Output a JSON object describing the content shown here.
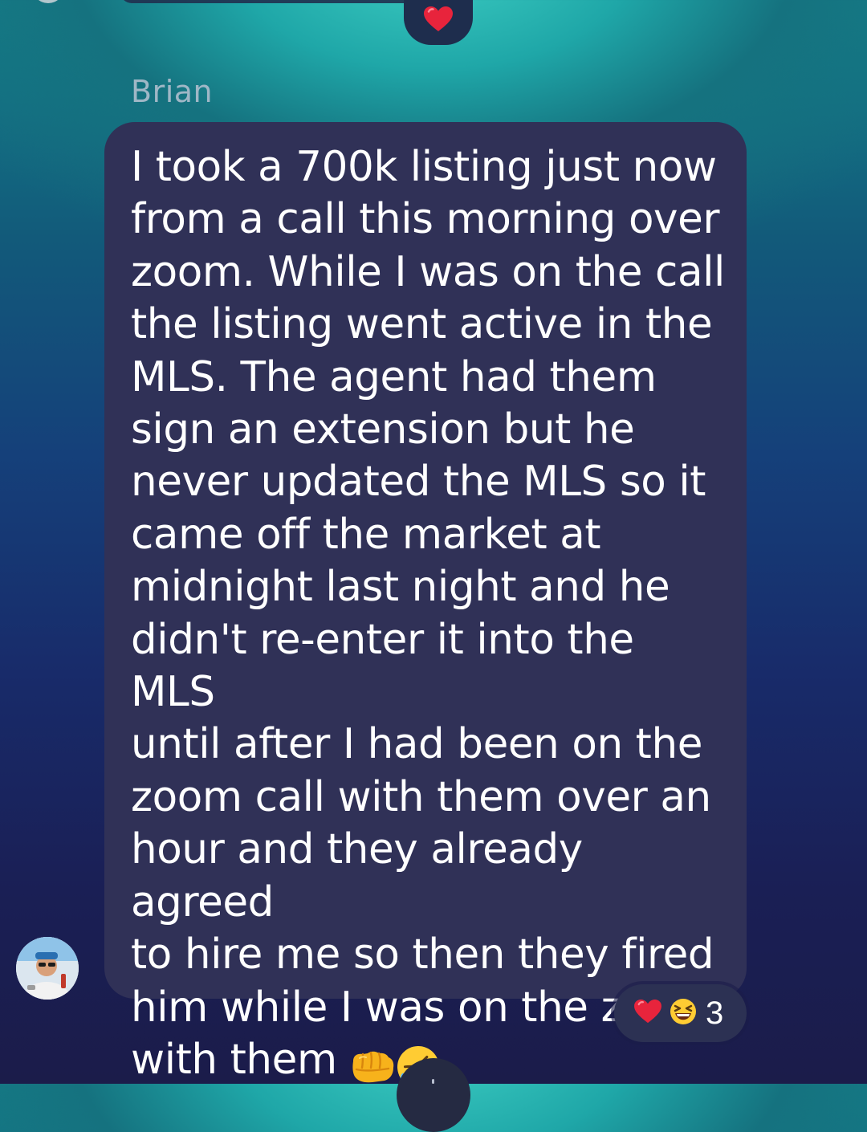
{
  "previous_message": {
    "reaction_icon": "red-heart"
  },
  "message": {
    "sender": "Brian",
    "text": "I took a 700k listing just now\nfrom a call this morning over\nzoom. While I was on the call\nthe listing went active in the\nMLS. The agent had them\nsign an extension but he\nnever updated the MLS so it\ncame off the market at\nmidnight last night and he\ndidn't re-enter it into the MLS\nuntil after I had been on the\nzoom call with them over an\nhour and they already agreed\nto hire me so then they fired\nhim while I was on the zoom\nwith them",
    "trailing_emojis": [
      "oncoming-fist",
      "rolling-on-the-floor-laughing"
    ],
    "reactions": {
      "icons": [
        "red-heart",
        "grinning-squinting-face"
      ],
      "count": "3"
    }
  },
  "colors": {
    "bubble": "#303157",
    "sender_name": "#9fb7c6",
    "message_text": "#ffffff",
    "heart": "#e8243c"
  }
}
